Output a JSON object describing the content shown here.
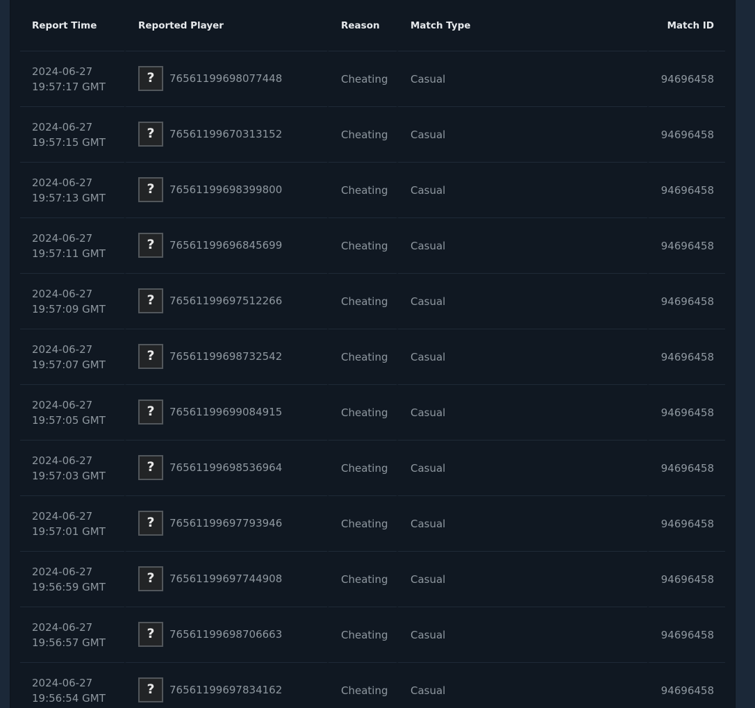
{
  "table": {
    "headers": {
      "report_time": "Report Time",
      "reported_player": "Reported Player",
      "reason": "Reason",
      "match_type": "Match Type",
      "match_id": "Match ID"
    },
    "avatar_glyph": "?",
    "rows": [
      {
        "date": "2024-06-27",
        "time": "19:57:17 GMT",
        "player": "76561199698077448",
        "reason": "Cheating",
        "match_type": "Casual",
        "match_id": "94696458"
      },
      {
        "date": "2024-06-27",
        "time": "19:57:15 GMT",
        "player": "76561199670313152",
        "reason": "Cheating",
        "match_type": "Casual",
        "match_id": "94696458"
      },
      {
        "date": "2024-06-27",
        "time": "19:57:13 GMT",
        "player": "76561199698399800",
        "reason": "Cheating",
        "match_type": "Casual",
        "match_id": "94696458"
      },
      {
        "date": "2024-06-27",
        "time": "19:57:11 GMT",
        "player": "76561199696845699",
        "reason": "Cheating",
        "match_type": "Casual",
        "match_id": "94696458"
      },
      {
        "date": "2024-06-27",
        "time": "19:57:09 GMT",
        "player": "76561199697512266",
        "reason": "Cheating",
        "match_type": "Casual",
        "match_id": "94696458"
      },
      {
        "date": "2024-06-27",
        "time": "19:57:07 GMT",
        "player": "76561199698732542",
        "reason": "Cheating",
        "match_type": "Casual",
        "match_id": "94696458"
      },
      {
        "date": "2024-06-27",
        "time": "19:57:05 GMT",
        "player": "76561199699084915",
        "reason": "Cheating",
        "match_type": "Casual",
        "match_id": "94696458"
      },
      {
        "date": "2024-06-27",
        "time": "19:57:03 GMT",
        "player": "76561199698536964",
        "reason": "Cheating",
        "match_type": "Casual",
        "match_id": "94696458"
      },
      {
        "date": "2024-06-27",
        "time": "19:57:01 GMT",
        "player": "76561199697793946",
        "reason": "Cheating",
        "match_type": "Casual",
        "match_id": "94696458"
      },
      {
        "date": "2024-06-27",
        "time": "19:56:59 GMT",
        "player": "76561199697744908",
        "reason": "Cheating",
        "match_type": "Casual",
        "match_id": "94696458"
      },
      {
        "date": "2024-06-27",
        "time": "19:56:57 GMT",
        "player": "76561199698706663",
        "reason": "Cheating",
        "match_type": "Casual",
        "match_id": "94696458"
      },
      {
        "date": "2024-06-27",
        "time": "19:56:54 GMT",
        "player": "76561199697834162",
        "reason": "Cheating",
        "match_type": "Casual",
        "match_id": "94696458"
      }
    ]
  }
}
